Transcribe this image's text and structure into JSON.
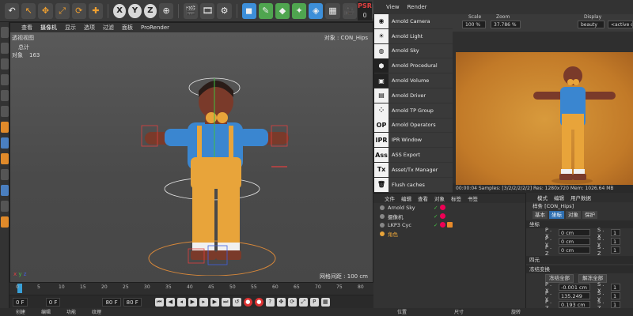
{
  "toolbar": {
    "psr_label": "PSR",
    "psr_value": "0",
    "axis_buttons": [
      "X",
      "Y",
      "Z"
    ]
  },
  "viewport": {
    "menu": [
      "查看",
      "摄像机",
      "显示",
      "选项",
      "过滤",
      "面板",
      "ProRender"
    ],
    "active_menu_index": 1,
    "perspective_label": "透视视图",
    "object_label": "对象 : CON_Hips",
    "info_rows": [
      {
        "label": "",
        "value": "总计"
      },
      {
        "label": "对象",
        "value": "163"
      }
    ],
    "grid_spacing": "网格间距 : 100 cm"
  },
  "timeline": {
    "ticks": [
      "0",
      "5",
      "10",
      "15",
      "20",
      "25",
      "30",
      "35",
      "40",
      "45",
      "50",
      "55",
      "60",
      "65",
      "70",
      "75",
      "80"
    ],
    "current_frame": "0 F",
    "start_frame": "0 F",
    "end_frame": "80 F",
    "end_frame2": "80 F",
    "field_right": "0 F"
  },
  "arnold_menu": {
    "items": [
      {
        "label": "Arnold Camera",
        "icon": "camera-icon",
        "glyph": "◉"
      },
      {
        "label": "Arnold Light",
        "icon": "bulb-icon",
        "glyph": "☀"
      },
      {
        "label": "Arnold Sky",
        "icon": "sky-icon",
        "glyph": "◍"
      },
      {
        "label": "Arnold Procedural",
        "icon": "procedural-icon",
        "glyph": "⬢"
      },
      {
        "label": "Arnold Volume",
        "icon": "volume-icon",
        "glyph": "▣"
      },
      {
        "label": "Arnold Driver",
        "icon": "driver-icon",
        "glyph": "▤"
      },
      {
        "label": "Arnold TP Group",
        "icon": "tp-group-icon",
        "glyph": "⁘"
      },
      {
        "label": "Arnold Operators",
        "icon": "operators-icon",
        "glyph": "OP"
      },
      {
        "label": "IPR Window",
        "icon": "ipr-icon",
        "glyph": "IPR"
      },
      {
        "label": "ASS Export",
        "icon": "ass-export-icon",
        "glyph": "Ass"
      },
      {
        "label": "Asset/Tx Manager",
        "icon": "tx-manager-icon",
        "glyph": "Tx"
      },
      {
        "label": "Flush caches",
        "icon": "trash-icon",
        "glyph": "🗑"
      }
    ]
  },
  "render_view": {
    "menu": [
      "View",
      "Render"
    ],
    "scale_label": "Scale",
    "scale_value": "100 %",
    "zoom_label": "Zoom",
    "zoom_value": "37.786 %",
    "display_label": "Display",
    "display_value": "beauty",
    "camera_value": "<active cam",
    "status": "00:00:04  Samples: [3/2/2/2/2/2]  Res: 1280x720  Mem: 1026.64 MB"
  },
  "object_manager": {
    "menu": [
      "文件",
      "编辑",
      "查看",
      "对象",
      "标签",
      "书签"
    ],
    "rows": [
      {
        "name": "Arnold Sky",
        "tags": 1
      },
      {
        "name": "摄像机",
        "tags": 1
      },
      {
        "name": "LKP3 Cyc",
        "tags": 2
      },
      {
        "name": "角色",
        "tags": 0
      }
    ]
  },
  "attributes": {
    "menu": [
      "模式",
      "编辑",
      "用户数据"
    ],
    "title": "样条 [CON_Hips]",
    "tabs": [
      "基本",
      "坐标",
      "对象",
      "保护"
    ],
    "active_tab_index": 1,
    "section_coords": "坐标",
    "rows_top": [
      {
        "k": "P . X",
        "v": "0 cm",
        "k2": "S . X",
        "v2": "1"
      },
      {
        "k": "P . Y",
        "v": "0 cm",
        "k2": "S . Y",
        "v2": "1"
      },
      {
        "k": "P . Z",
        "v": "0 cm",
        "k2": "S . Z",
        "v2": "1"
      }
    ],
    "section_quat": "四元",
    "section_freeze": "冻结变换",
    "freeze_all": "冻结全部",
    "unfreeze_all": "解冻全部",
    "rows_bottom": [
      {
        "k": "P . X",
        "v": "-0.001 cm",
        "k2": "S . X",
        "v2": "1"
      },
      {
        "k": "P . Y",
        "v": "135.249 cm",
        "k2": "S . Y",
        "v2": "1"
      },
      {
        "k": "P . Z",
        "v": "0.193 cm",
        "k2": "S . Z",
        "v2": "1"
      }
    ]
  },
  "bottom_tabs": [
    "创建",
    "编辑",
    "功能",
    "纹理"
  ],
  "coord_tabs": [
    "位置",
    "尺寸",
    "旋转"
  ]
}
